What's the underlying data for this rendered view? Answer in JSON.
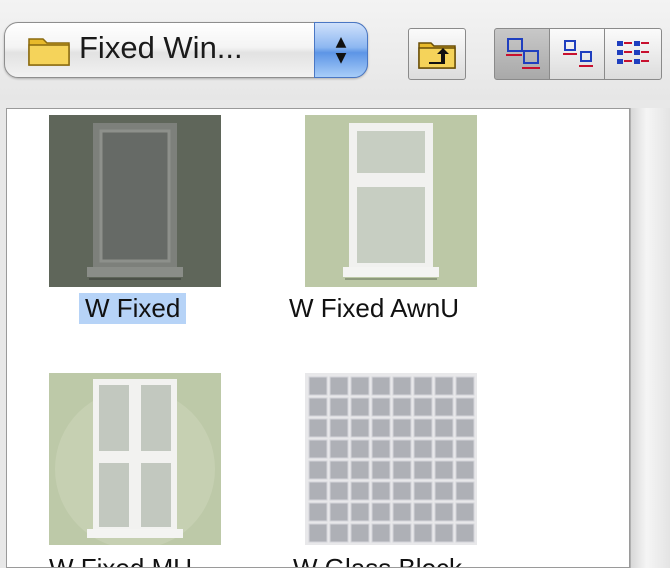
{
  "toolbar": {
    "folder_popup": {
      "selected": "Fixed Win...",
      "icon": "folder-icon"
    },
    "up_button_icon": "folder-up-icon",
    "view_buttons": [
      {
        "name": "large-icon-view",
        "selected": true
      },
      {
        "name": "small-icon-view",
        "selected": false
      },
      {
        "name": "list-view",
        "selected": false
      }
    ]
  },
  "items": [
    {
      "label": "W Fixed",
      "selected": true
    },
    {
      "label": "W Fixed AwnU",
      "selected": false
    },
    {
      "label": "W Fixed MU",
      "selected": false
    },
    {
      "label": "W Glass Block",
      "selected": false
    }
  ],
  "colors": {
    "selection": "#b6d3f7",
    "popup_arrow_accent": "#5d95e6",
    "view_icon_blue": "#1f3fbf",
    "view_icon_red": "#c8102e"
  }
}
